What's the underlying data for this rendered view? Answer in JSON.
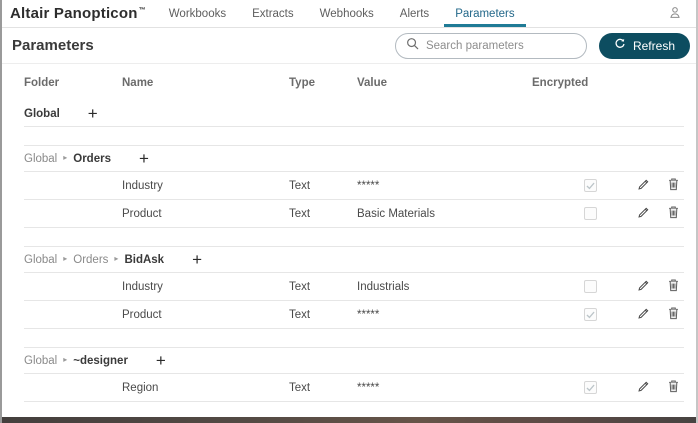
{
  "navbar": {
    "logo": "Altair Panopticon",
    "trademark": "™",
    "items": [
      {
        "label": "Workbooks",
        "active": false
      },
      {
        "label": "Extracts",
        "active": false
      },
      {
        "label": "Webhooks",
        "active": false
      },
      {
        "label": "Alerts",
        "active": false
      },
      {
        "label": "Parameters",
        "active": true
      }
    ]
  },
  "page": {
    "title": "Parameters",
    "search": {
      "placeholder": "Search parameters"
    },
    "refresh_button": {
      "label": "Refresh"
    }
  },
  "table": {
    "columns": {
      "folder": "Folder",
      "name": "Name",
      "type": "Type",
      "value": "Value",
      "encrypted": "Encrypted"
    },
    "groups": [
      {
        "path": [
          "Global"
        ],
        "rows": []
      },
      {
        "path": [
          "Global",
          "Orders"
        ],
        "rows": [
          {
            "name": "Industry",
            "type": "Text",
            "value": "*****",
            "encrypted": true
          },
          {
            "name": "Product",
            "type": "Text",
            "value": "Basic Materials",
            "encrypted": false
          }
        ]
      },
      {
        "path": [
          "Global",
          "Orders",
          "BidAsk"
        ],
        "rows": [
          {
            "name": "Industry",
            "type": "Text",
            "value": "Industrials",
            "encrypted": false
          },
          {
            "name": "Product",
            "type": "Text",
            "value": "*****",
            "encrypted": true
          }
        ]
      },
      {
        "path": [
          "Global",
          "~designer"
        ],
        "rows": [
          {
            "name": "Region",
            "type": "Text",
            "value": "*****",
            "encrypted": true
          }
        ]
      }
    ]
  },
  "icons": {
    "plus": "+",
    "breadcrumb_separator": "▸"
  },
  "colors": {
    "active_tab_underline": "#1f7b96",
    "active_tab_text": "#23688a",
    "refresh_button_bg": "#0d4d60",
    "row_border": "#e6e6e6"
  }
}
